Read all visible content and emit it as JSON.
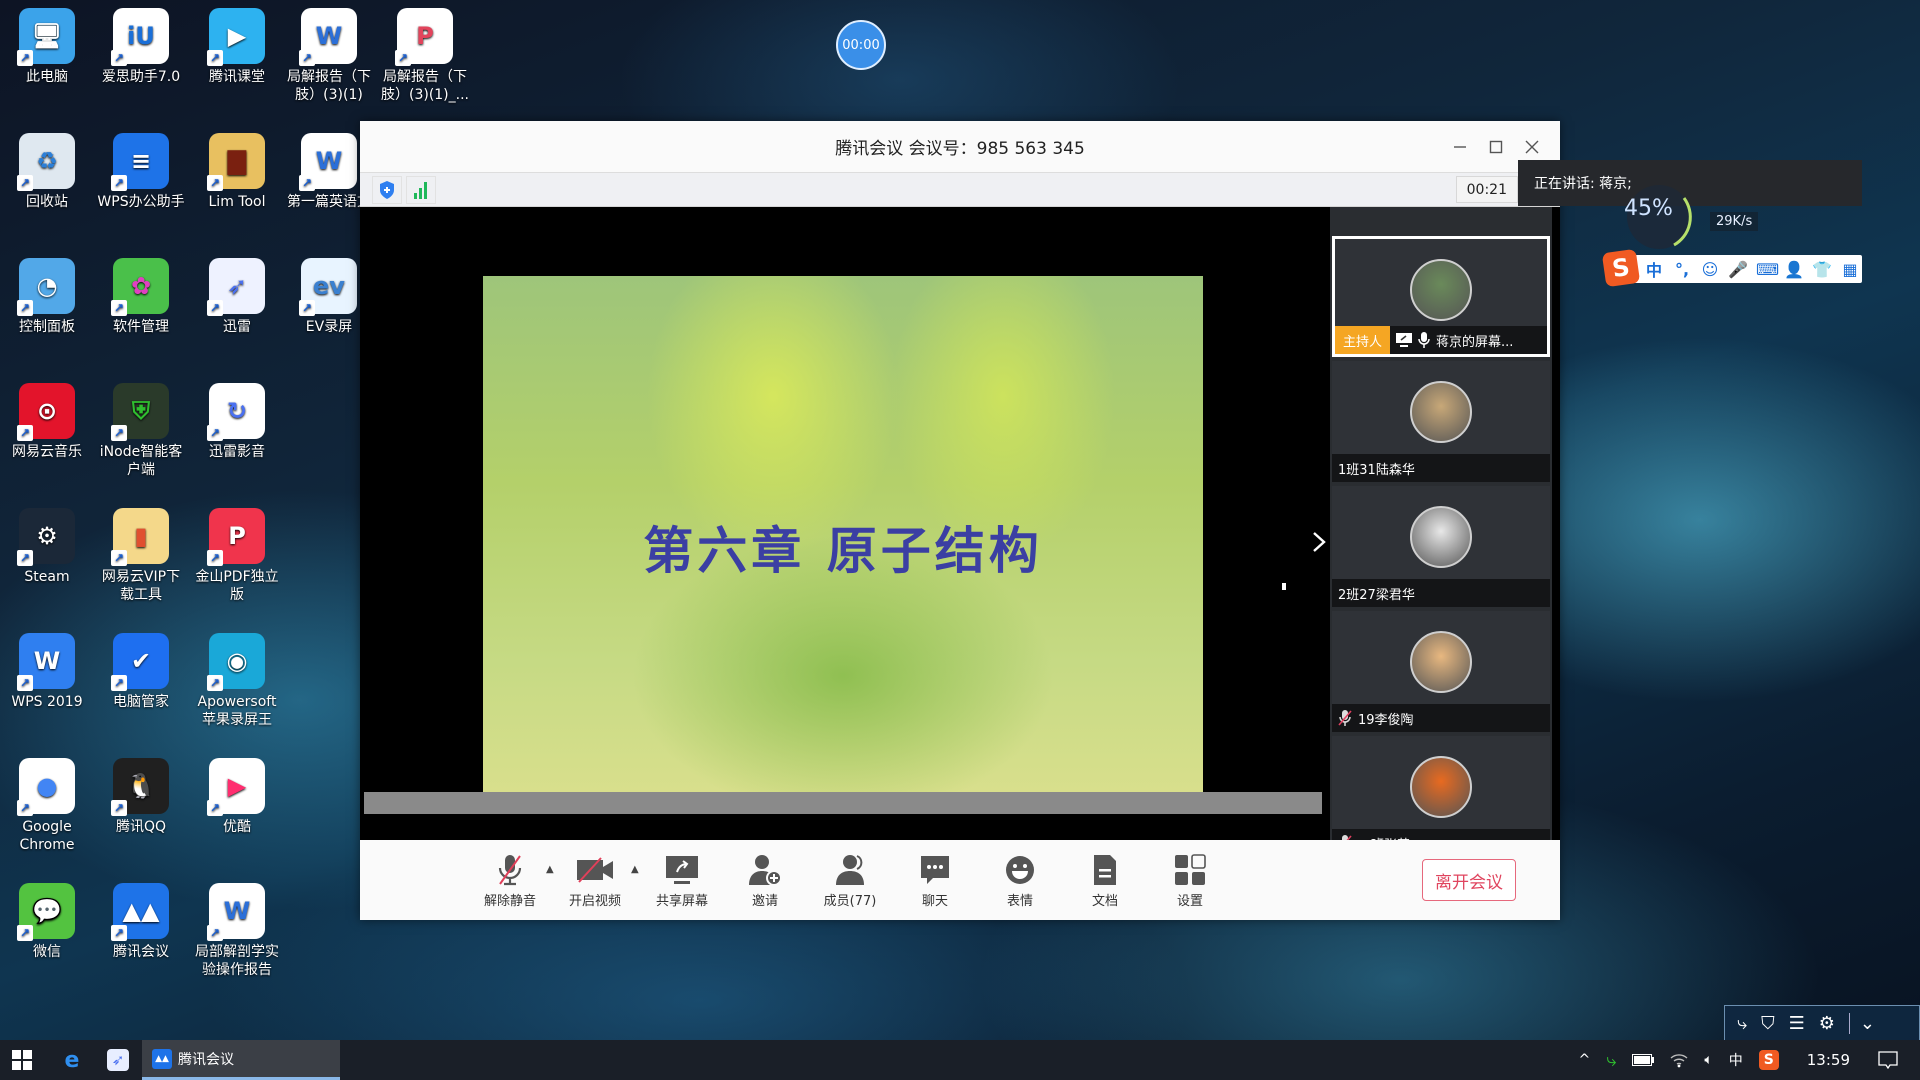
{
  "desktop": {
    "icons": [
      {
        "label": "此电脑",
        "icon": "computer-icon",
        "bg": "#3ba3ea",
        "glyph": "🖥"
      },
      {
        "label": "爱思助手7.0",
        "icon": "aisi-icon",
        "bg": "#ffffff",
        "glyph": "iU",
        "fg": "#1a6fd8"
      },
      {
        "label": "腾讯课堂",
        "icon": "tencent-classroom-icon",
        "bg": "#2db2f0",
        "glyph": "▶"
      },
      {
        "label": "局解报告（下肢）(3)(1)",
        "icon": "word-doc-icon",
        "bg": "#ffffff",
        "glyph": "W",
        "fg": "#2b6fd8"
      },
      {
        "label": "局解报告（下肢）(3)(1)_...",
        "icon": "wps-pdf-doc-icon",
        "bg": "#ffffff",
        "glyph": "P",
        "fg": "#e2445c"
      },
      {
        "label": "回收站",
        "icon": "recycle-bin-icon",
        "bg": "#dfe8f0",
        "glyph": "♻",
        "fg": "#2b7fd8"
      },
      {
        "label": "WPS办公助手",
        "icon": "wps-assistant-icon",
        "bg": "#1e73e8",
        "glyph": "≡"
      },
      {
        "label": "Lim Tool",
        "icon": "folder-icon",
        "bg": "#e8c060",
        "glyph": "▇",
        "fg": "#7a2010"
      },
      {
        "label": "第一篇英语文",
        "icon": "word-doc-icon",
        "bg": "#ffffff",
        "glyph": "W",
        "fg": "#2b6fd8"
      },
      {
        "label": "控制面板",
        "icon": "control-panel-icon",
        "bg": "#52a8e8",
        "glyph": "◔"
      },
      {
        "label": "软件管理",
        "icon": "software-manager-icon",
        "bg": "#4ac04a",
        "glyph": "✿",
        "fg": "#e040c0"
      },
      {
        "label": "迅雷",
        "icon": "thunder-icon",
        "bg": "#eef2ff",
        "glyph": "➶",
        "fg": "#4a70f0"
      },
      {
        "label": "EV录屏",
        "icon": "ev-recorder-icon",
        "bg": "#e8f4ff",
        "glyph": "ev",
        "fg": "#3a80d0"
      },
      {
        "label": "网易云音乐",
        "icon": "netease-music-icon",
        "bg": "#e3142b",
        "glyph": "⊙"
      },
      {
        "label": "iNode智能客户端",
        "icon": "inode-icon",
        "bg": "#2a3a2a",
        "glyph": "⛨",
        "fg": "#2fbf2f"
      },
      {
        "label": "迅雷影音",
        "icon": "thunder-player-icon",
        "bg": "#ffffff",
        "glyph": "↻",
        "fg": "#4a70f0"
      },
      {
        "label": "Steam",
        "icon": "steam-icon",
        "bg": "#1b2838",
        "glyph": "⚙"
      },
      {
        "label": "网易云VIP下载工具",
        "icon": "folder-icon",
        "bg": "#f4d88a",
        "glyph": "▮",
        "fg": "#e05030"
      },
      {
        "label": "金山PDF独立版",
        "icon": "kingsoft-pdf-icon",
        "bg": "#f0344c",
        "glyph": "P"
      },
      {
        "label": "WPS 2019",
        "icon": "wps-icon",
        "bg": "#2f7ff0",
        "glyph": "W"
      },
      {
        "label": "电脑管家",
        "icon": "pc-manager-icon",
        "bg": "#1e6ff0",
        "glyph": "✔"
      },
      {
        "label": "Apowersoft苹果录屏王",
        "icon": "apowersoft-icon",
        "bg": "#1aa8d8",
        "glyph": "◉"
      },
      {
        "label": "Google Chrome",
        "icon": "chrome-icon",
        "bg": "#ffffff",
        "glyph": "●",
        "fg": "#4285f4"
      },
      {
        "label": "腾讯QQ",
        "icon": "qq-icon",
        "bg": "#202020",
        "glyph": "🐧"
      },
      {
        "label": "优酷",
        "icon": "youku-icon",
        "bg": "#ffffff",
        "glyph": "▶",
        "fg": "#ff2d6f"
      },
      {
        "label": "微信",
        "icon": "wechat-icon",
        "bg": "#53c340",
        "glyph": "💬"
      },
      {
        "label": "腾讯会议",
        "icon": "tencent-meeting-icon",
        "bg": "#1e73e8",
        "glyph": "▲▲"
      },
      {
        "label": "局部解剖学实验操作报告",
        "icon": "word-doc-icon",
        "bg": "#ffffff",
        "glyph": "W",
        "fg": "#2b6fd8"
      }
    ]
  },
  "timer_bubble": "00:00",
  "meeting": {
    "title": "腾讯会议 会议号：985 563 345",
    "duration": "00:21",
    "slide_title": "第六章  原子结构",
    "participants": [
      {
        "name": "蒋京的屏幕...",
        "role": "主持人",
        "sharing": true,
        "mic": "on",
        "avatar_color": "#6a8a5a"
      },
      {
        "name": "1班31陆森华",
        "mic": "none",
        "avatar_color": "#c8a878"
      },
      {
        "name": "2班27梁君华",
        "mic": "none",
        "avatar_color": "#e8e8e8"
      },
      {
        "name": "19李俊陶",
        "mic": "muted",
        "avatar_color": "#e8b880"
      },
      {
        "name": "二班张英",
        "mic": "muted",
        "avatar_color": "#e86a20"
      }
    ],
    "toolbar": [
      {
        "label": "解除静音",
        "icon": "mic-muted-icon",
        "caret": true
      },
      {
        "label": "开启视频",
        "icon": "camera-off-icon",
        "caret": true
      },
      {
        "label": "共享屏幕",
        "icon": "share-screen-icon"
      },
      {
        "label": "邀请",
        "icon": "invite-user-icon"
      },
      {
        "label": "成员(77)",
        "icon": "members-icon"
      },
      {
        "label": "聊天",
        "icon": "chat-icon"
      },
      {
        "label": "表情",
        "icon": "emoji-icon"
      },
      {
        "label": "文档",
        "icon": "document-icon"
      },
      {
        "label": "设置",
        "icon": "settings-grid-icon"
      }
    ],
    "leave_label": "离开会议"
  },
  "speaking": "正在讲话: 蒋京;",
  "net_widget": {
    "percent": "45%",
    "speed": "29K/s"
  },
  "ime": {
    "items": [
      "中",
      "°,",
      "☺",
      "🎤",
      "⌨",
      "👤",
      "👕",
      "▦"
    ]
  },
  "taskbar": {
    "active_app": "腾讯会议",
    "clock": "13:59",
    "ime_mode": "中"
  }
}
